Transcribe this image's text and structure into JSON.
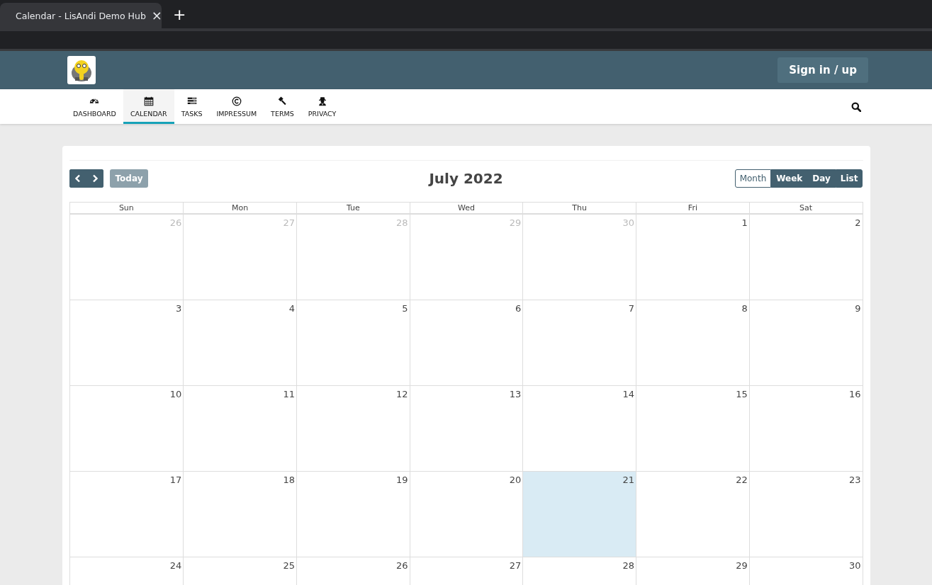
{
  "browser": {
    "tab_title": "Calendar - LisAndi Demo Hub",
    "close": "×",
    "new_tab": "+"
  },
  "header": {
    "sign_in": "Sign in / up"
  },
  "nav": [
    {
      "label": "DASHBOARD",
      "selected": false
    },
    {
      "label": "CALENDAR",
      "selected": true
    },
    {
      "label": "TASKS",
      "selected": false
    },
    {
      "label": "IMPRESSUM",
      "selected": false
    },
    {
      "label": "TERMS",
      "selected": false
    },
    {
      "label": "PRIVACY",
      "selected": false
    }
  ],
  "toolbar": {
    "title": "July 2022",
    "today": "Today",
    "today_disabled": true,
    "views": [
      {
        "label": "Month",
        "selected": true
      },
      {
        "label": "Week",
        "selected": false
      },
      {
        "label": "Day",
        "selected": false
      },
      {
        "label": "List",
        "selected": false
      }
    ]
  },
  "weekdays": [
    "Sun",
    "Mon",
    "Tue",
    "Wed",
    "Thu",
    "Fri",
    "Sat"
  ],
  "weeks": [
    [
      {
        "day": "26",
        "other_month": true,
        "today": false
      },
      {
        "day": "27",
        "other_month": true,
        "today": false
      },
      {
        "day": "28",
        "other_month": true,
        "today": false
      },
      {
        "day": "29",
        "other_month": true,
        "today": false
      },
      {
        "day": "30",
        "other_month": true,
        "today": false
      },
      {
        "day": "1",
        "other_month": false,
        "today": false
      },
      {
        "day": "2",
        "other_month": false,
        "today": false
      }
    ],
    [
      {
        "day": "3",
        "other_month": false,
        "today": false
      },
      {
        "day": "4",
        "other_month": false,
        "today": false
      },
      {
        "day": "5",
        "other_month": false,
        "today": false
      },
      {
        "day": "6",
        "other_month": false,
        "today": false
      },
      {
        "day": "7",
        "other_month": false,
        "today": false
      },
      {
        "day": "8",
        "other_month": false,
        "today": false
      },
      {
        "day": "9",
        "other_month": false,
        "today": false
      }
    ],
    [
      {
        "day": "10",
        "other_month": false,
        "today": false
      },
      {
        "day": "11",
        "other_month": false,
        "today": false
      },
      {
        "day": "12",
        "other_month": false,
        "today": false
      },
      {
        "day": "13",
        "other_month": false,
        "today": false
      },
      {
        "day": "14",
        "other_month": false,
        "today": false
      },
      {
        "day": "15",
        "other_month": false,
        "today": false
      },
      {
        "day": "16",
        "other_month": false,
        "today": false
      }
    ],
    [
      {
        "day": "17",
        "other_month": false,
        "today": false
      },
      {
        "day": "18",
        "other_month": false,
        "today": false
      },
      {
        "day": "19",
        "other_month": false,
        "today": false
      },
      {
        "day": "20",
        "other_month": false,
        "today": false
      },
      {
        "day": "21",
        "other_month": false,
        "today": true
      },
      {
        "day": "22",
        "other_month": false,
        "today": false
      },
      {
        "day": "23",
        "other_month": false,
        "today": false
      }
    ],
    [
      {
        "day": "24",
        "other_month": false,
        "today": false
      },
      {
        "day": "25",
        "other_month": false,
        "today": false
      },
      {
        "day": "26",
        "other_month": false,
        "today": false
      },
      {
        "day": "27",
        "other_month": false,
        "today": false
      },
      {
        "day": "28",
        "other_month": false,
        "today": false
      },
      {
        "day": "29",
        "other_month": false,
        "today": false
      },
      {
        "day": "30",
        "other_month": false,
        "today": false
      }
    ]
  ]
}
